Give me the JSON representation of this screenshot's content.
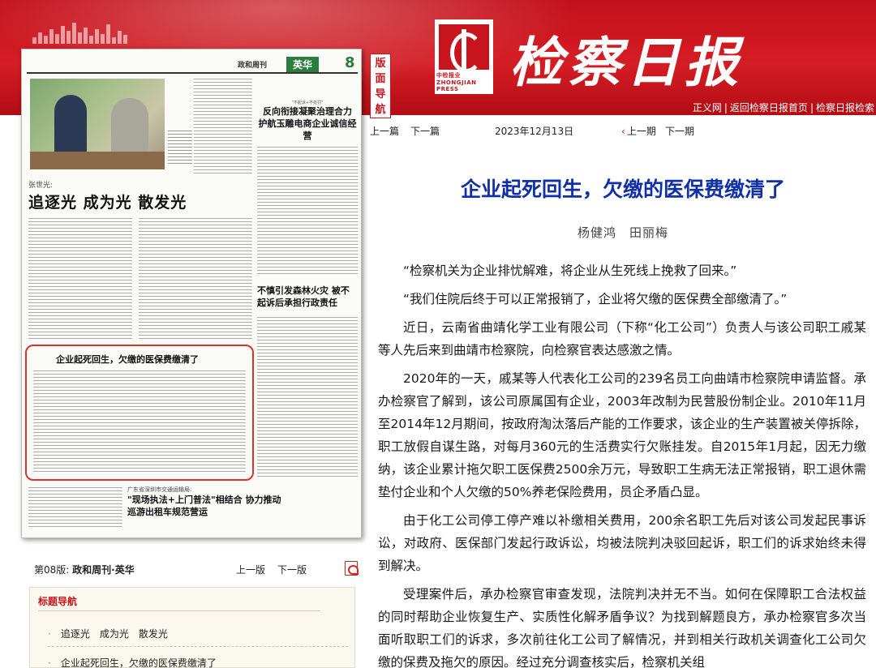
{
  "header": {
    "logo_text": "中检报业 ZHONGJIAN PRESS",
    "masthead": "检察日报",
    "links": [
      "正义网",
      "返回检察日报首页",
      "检察日报检索"
    ],
    "side_tab": "版面导航"
  },
  "page_preview": {
    "section_name": "政和周刊",
    "tag": "英华",
    "page_no": "8",
    "person_name": "张世光:",
    "title_main": "追逐光 成为光 散发光",
    "right_sub": "\"不起诉+不处罚\"",
    "right_title": "反向衔接凝聚治理合力 护航玉雕电商企业诚信经营",
    "mid_title": "不慎引发森林火灾 被不起诉后承担行政责任",
    "highlight_title": "企业起死回生，欠缴的医保费缴清了",
    "bottom_sub": "广东省深圳市交通运输局:",
    "bottom_title": "\"现场执法+上门普法\"相结合 协力推动巡游出租车规范营运"
  },
  "edition_bar": {
    "label": "第08版:",
    "name": "政和周刊·英华",
    "prev": "上一版",
    "next": "下一版"
  },
  "title_nav": {
    "heading": "标题导航",
    "items": [
      "追逐光　成为光　散发光",
      "企业起死回生，欠缴的医保费缴清了"
    ]
  },
  "article_nav": {
    "prev": "上一篇",
    "next": "下一篇",
    "date": "2023年12月13日",
    "prev_issue": "上一期",
    "next_issue": "下一期"
  },
  "article": {
    "title": "企业起死回生，欠缴的医保费缴清了",
    "authors": "杨健鸿　田丽梅",
    "paragraphs": [
      "“检察机关为企业排忧解难，将企业从生死线上挽救了回来。”",
      "“我们住院后终于可以正常报销了，企业将欠缴的医保费全部缴清了。”",
      "近日，云南省曲靖化学工业有限公司（下称“化工公司”）负责人与该公司职工戚某等人先后来到曲靖市检察院，向检察官表达感激之情。",
      "2020年的一天，戚某等人代表化工公司的239名员工向曲靖市检察院申请监督。承办检察官了解到，该公司原属国有企业，2003年改制为民营股份制企业。2010年11月至2014年12月期间，按政府淘汰落后产能的工作要求，该企业的生产装置被关停拆除，职工放假自谋生路，对每月360元的生活费实行欠账挂发。自2015年1月起，因无力缴纳，该企业累计拖欠职工医保费2500余万元，导致职工生病无法正常报销，职工退休需垫付企业和个人欠缴的50%养老保险费用，员企矛盾凸显。",
      "由于化工公司停工停产难以补缴相关费用，200余名职工先后对该公司发起民事诉讼，对政府、医保部门发起行政诉讼，均被法院判决驳回起诉，职工们的诉求始终未得到解决。",
      "受理案件后，承办检察官审查发现，法院判决并无不当。如何在保障职工合法权益的同时帮助企业恢复生产、实质性化解矛盾争议？为找到解题良方，承办检察官多次当面听取职工们的诉求，多次前往化工公司了解情况，并到相关行政机关调查化工公司欠缴的保费及拖欠的原因。经过充分调查核实后，检察机关组"
    ]
  }
}
